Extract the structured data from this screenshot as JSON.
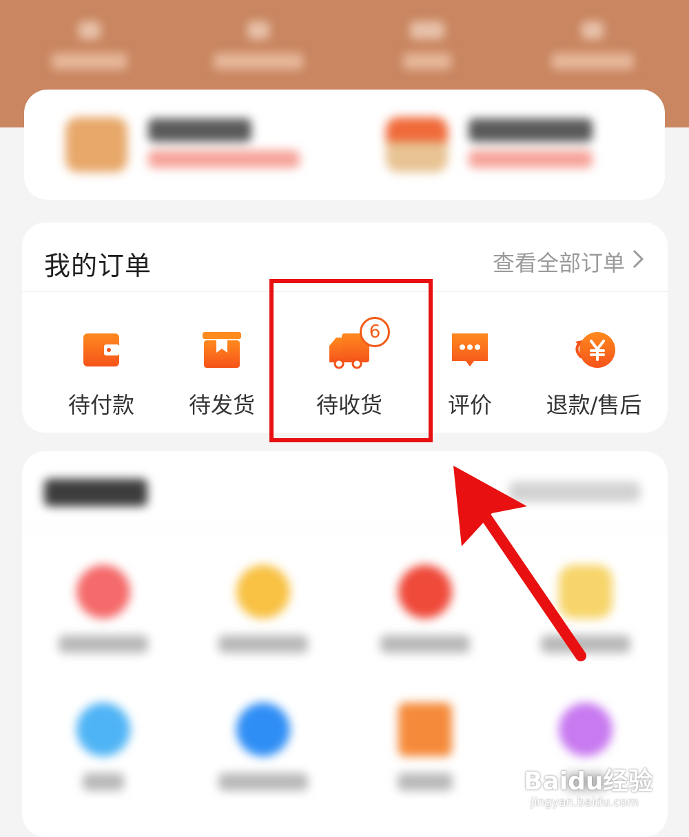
{
  "orders": {
    "title": "我的订单",
    "view_all": "查看全部订单",
    "items": [
      {
        "label": "待付款",
        "icon": "wallet-icon"
      },
      {
        "label": "待发货",
        "icon": "package-icon"
      },
      {
        "label": "待收货",
        "icon": "truck-icon",
        "badge": "6"
      },
      {
        "label": "评价",
        "icon": "comment-icon"
      },
      {
        "label": "退款/售后",
        "icon": "refund-icon"
      }
    ]
  },
  "watermark": {
    "brand": "Baidu经验",
    "url": "jingyan.baidu.com"
  },
  "colors": {
    "accent": "#f25b17",
    "highlight": "#e81010",
    "banner": "#c98660"
  }
}
